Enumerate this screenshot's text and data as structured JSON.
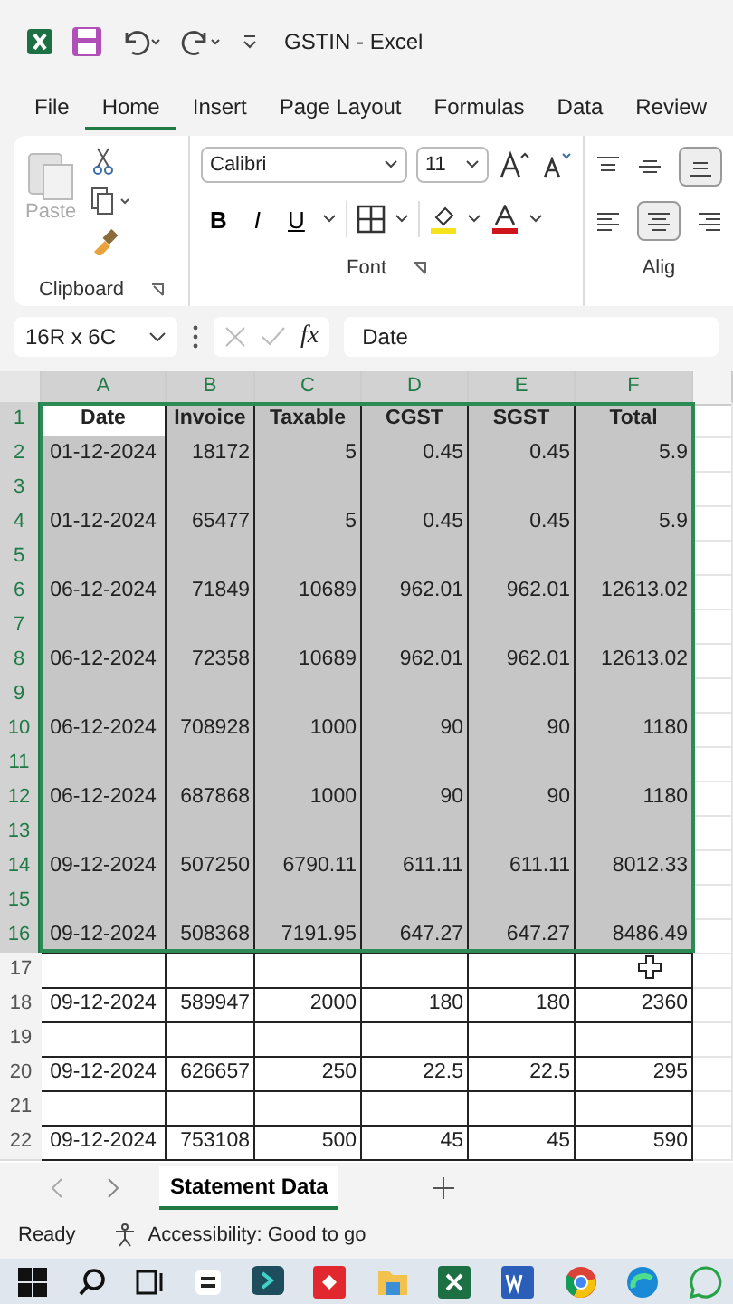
{
  "window": {
    "title": "GSTIN  -  Excel"
  },
  "menu_tabs": [
    {
      "label": "File",
      "selected": false
    },
    {
      "label": "Home",
      "selected": true
    },
    {
      "label": "Insert",
      "selected": false
    },
    {
      "label": "Page Layout",
      "selected": false
    },
    {
      "label": "Formulas",
      "selected": false
    },
    {
      "label": "Data",
      "selected": false
    },
    {
      "label": "Review",
      "selected": false
    }
  ],
  "ribbon": {
    "paste_label": "Paste",
    "font_name": "Calibri",
    "font_size": "11",
    "bold": "B",
    "italic": "I",
    "underline": "U",
    "groups": [
      "Clipboard",
      "Font",
      "Alig"
    ]
  },
  "formula_bar": {
    "name_box": "16R x 6C",
    "fx": "fx",
    "value": "Date"
  },
  "columns": [
    "A",
    "B",
    "C",
    "D",
    "E",
    "F"
  ],
  "rows": [
    {
      "number": "1",
      "selected": true,
      "cells": [
        "Date",
        "Invoice",
        "Taxable",
        "CGST",
        "SGST",
        "Total"
      ]
    },
    {
      "number": "2",
      "selected": true,
      "cells": [
        "01-12-2024",
        "18172",
        "5",
        "0.45",
        "0.45",
        "5.9"
      ]
    },
    {
      "number": "3",
      "selected": true
    },
    {
      "number": "4",
      "selected": true,
      "cells": [
        "01-12-2024",
        "65477",
        "5",
        "0.45",
        "0.45",
        "5.9"
      ]
    },
    {
      "number": "5",
      "selected": true
    },
    {
      "number": "6",
      "selected": true,
      "cells": [
        "06-12-2024",
        "71849",
        "10689",
        "962.01",
        "962.01",
        "12613.02"
      ]
    },
    {
      "number": "7",
      "selected": true
    },
    {
      "number": "8",
      "selected": true,
      "cells": [
        "06-12-2024",
        "72358",
        "10689",
        "962.01",
        "962.01",
        "12613.02"
      ]
    },
    {
      "number": "9",
      "selected": true
    },
    {
      "number": "10",
      "selected": true,
      "cells": [
        "06-12-2024",
        "708928",
        "1000",
        "90",
        "90",
        "1180"
      ]
    },
    {
      "number": "11",
      "selected": true
    },
    {
      "number": "12",
      "selected": true,
      "cells": [
        "06-12-2024",
        "687868",
        "1000",
        "90",
        "90",
        "1180"
      ]
    },
    {
      "number": "13",
      "selected": true
    },
    {
      "number": "14",
      "selected": true,
      "cells": [
        "09-12-2024",
        "507250",
        "6790.11",
        "611.11",
        "611.11",
        "8012.33"
      ]
    },
    {
      "number": "15",
      "selected": true
    },
    {
      "number": "16",
      "selected": true,
      "cells": [
        "09-12-2024",
        "508368",
        "7191.95",
        "647.27",
        "647.27",
        "8486.49"
      ]
    },
    {
      "number": "17",
      "selected": false
    },
    {
      "number": "18",
      "selected": false,
      "cells": [
        "09-12-2024",
        "589947",
        "2000",
        "180",
        "180",
        "2360"
      ]
    },
    {
      "number": "19",
      "selected": false
    },
    {
      "number": "20",
      "selected": false,
      "cells": [
        "09-12-2024",
        "626657",
        "250",
        "22.5",
        "22.5",
        "295"
      ]
    },
    {
      "number": "21",
      "selected": false
    },
    {
      "number": "22",
      "selected": false,
      "cells": [
        "09-12-2024",
        "753108",
        "500",
        "45",
        "45",
        "590"
      ]
    }
  ],
  "sheet_tabs": [
    {
      "label": "Statement Data",
      "selected": true
    }
  ],
  "status_bar": {
    "mode": "Ready",
    "accessibility": "Accessibility: Good to go"
  }
}
